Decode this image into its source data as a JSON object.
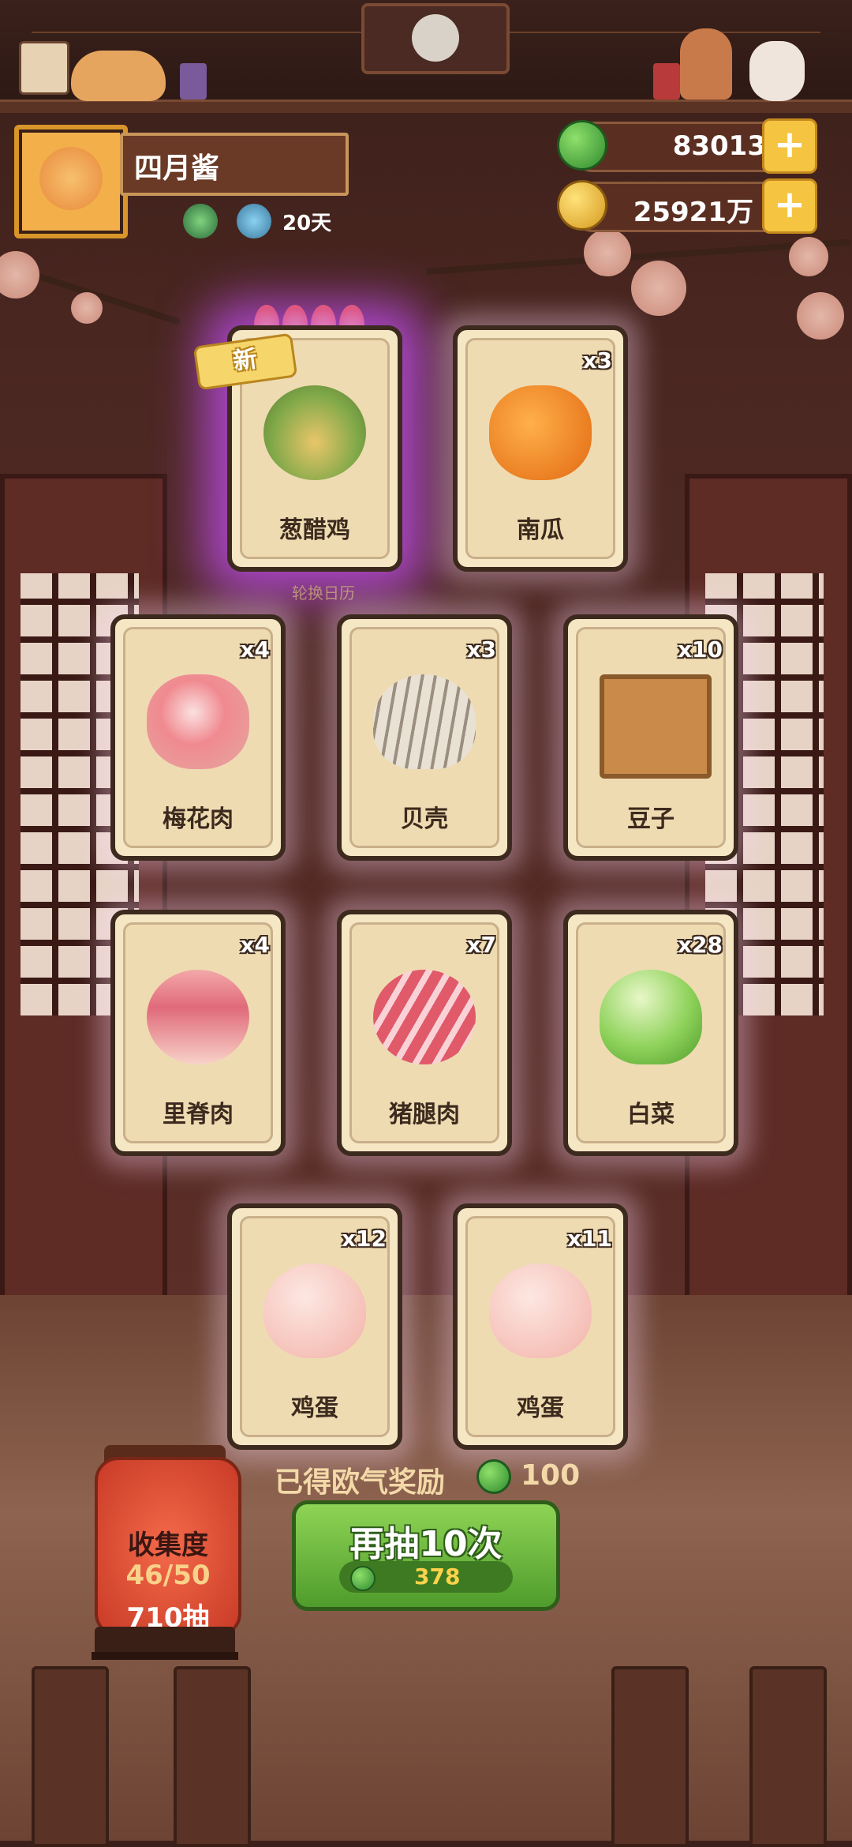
{
  "player": {
    "name": "四月酱",
    "days": "20天"
  },
  "currency": {
    "jade": "83013",
    "coins": "25921万"
  },
  "rotate_label": "轮换日历",
  "new_label": "新",
  "cards": [
    {
      "name": "葱醋鸡",
      "count": "",
      "new": true,
      "stars": 4,
      "art": "dish-icon"
    },
    {
      "name": "南瓜",
      "count": "x3",
      "art": "pumpkin-icon"
    },
    {
      "name": "梅花肉",
      "count": "x4",
      "art": "meat-icon"
    },
    {
      "name": "贝壳",
      "count": "x3",
      "art": "shell-icon"
    },
    {
      "name": "豆子",
      "count": "x10",
      "art": "beans-icon"
    },
    {
      "name": "里脊肉",
      "count": "x4",
      "art": "tenderloin-icon"
    },
    {
      "name": "猪腿肉",
      "count": "x7",
      "art": "pork-leg-icon"
    },
    {
      "name": "白菜",
      "count": "x28",
      "art": "cabbage-icon"
    },
    {
      "name": "鸡蛋",
      "count": "x12",
      "art": "egg-icon"
    },
    {
      "name": "鸡蛋",
      "count": "x11",
      "art": "egg-icon"
    }
  ],
  "reward": {
    "label": "已得欧气奖励",
    "amount": "100"
  },
  "collection": {
    "title": "收集度",
    "progress": "46/50",
    "draws": "710抽"
  },
  "redraw": {
    "label": "再抽10次",
    "cost": "378"
  }
}
